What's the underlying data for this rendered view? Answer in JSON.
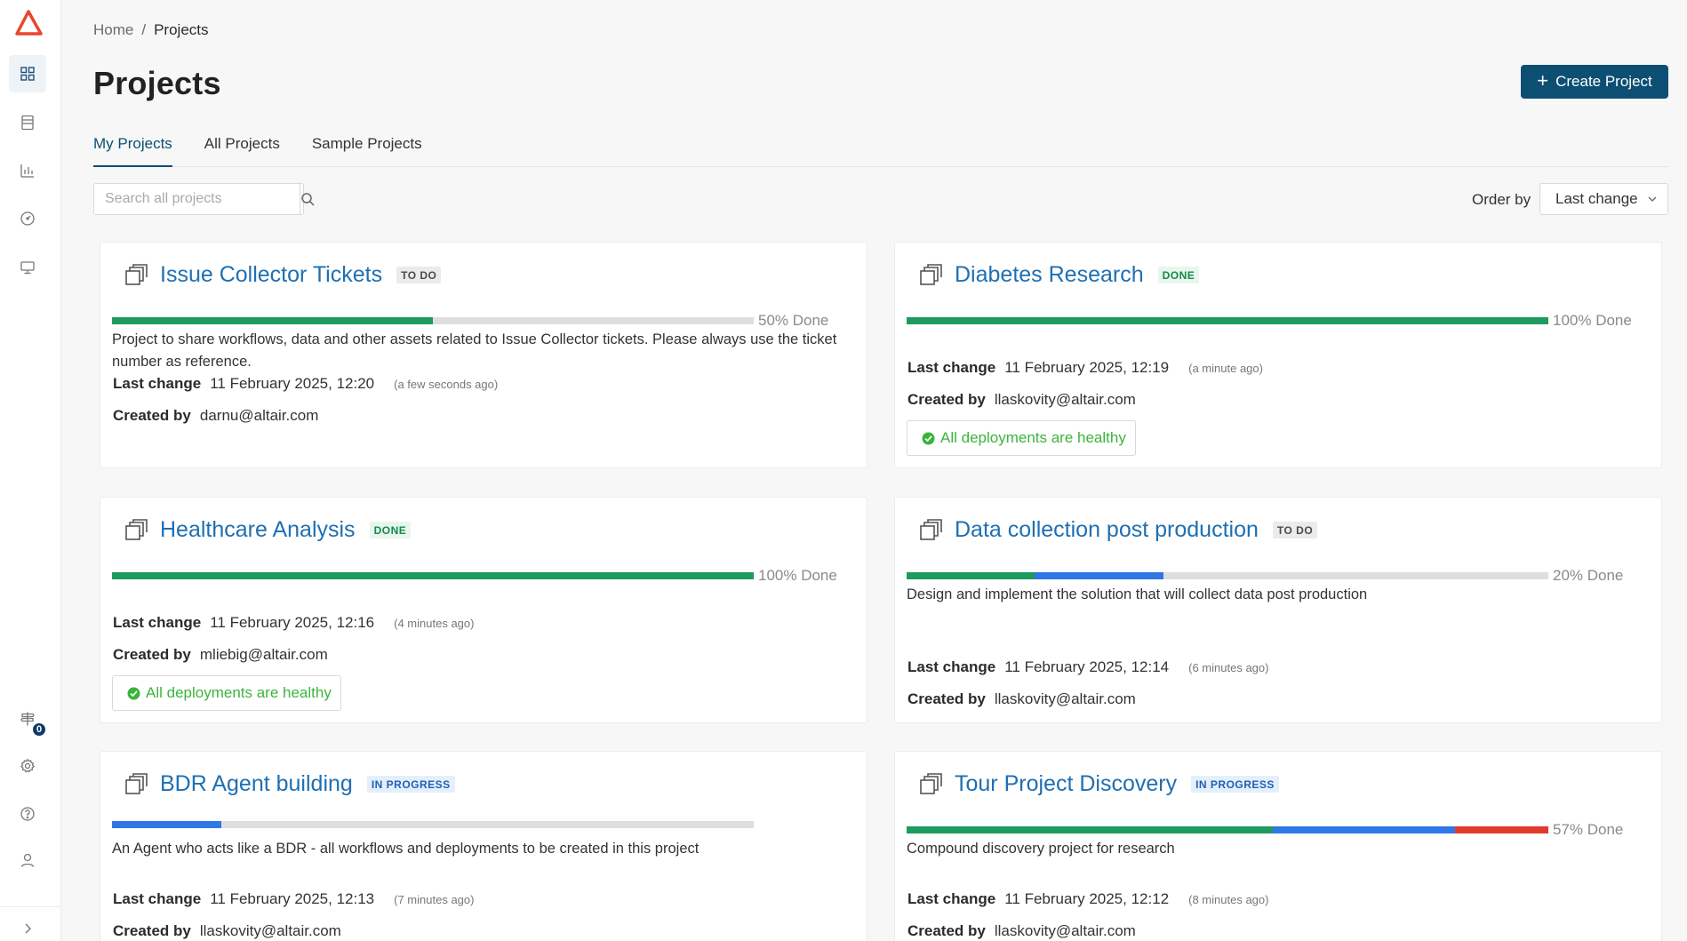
{
  "breadcrumb": {
    "home": "Home",
    "separator": "/",
    "current": "Projects"
  },
  "page": {
    "title": "Projects",
    "create_label": "Create Project"
  },
  "tabs": [
    {
      "label": "My Projects",
      "active": true
    },
    {
      "label": "All Projects",
      "active": false
    },
    {
      "label": "Sample Projects",
      "active": false
    }
  ],
  "search": {
    "placeholder": "Search all projects"
  },
  "order": {
    "label": "Order by",
    "value": "Last change"
  },
  "sidebar": {
    "notification_count": "0"
  },
  "labels": {
    "last_change": "Last change",
    "created_by": "Created by",
    "healthy": "All deployments are healthy"
  },
  "colors": {
    "accent": "#0d4f73",
    "link": "#1f6fb2",
    "green": "#1e9b5f",
    "blue": "#2f77e6",
    "red": "#e23b2e",
    "healthy": "#3cb43c"
  },
  "projects": [
    {
      "title": "Issue Collector Tickets",
      "status": "TO DO",
      "progress_label": "50% Done",
      "progress": [
        0.5,
        0,
        0
      ],
      "description": "Project to share workflows, data and other assets related to Issue Collector tickets. Please always use the ticket number as reference.",
      "last_change": "11 February 2025, 12:20",
      "ago": "(a few seconds ago)",
      "created_by": "darnu@altair.com",
      "healthy": false
    },
    {
      "title": "Diabetes Research",
      "status": "DONE",
      "progress_label": "100% Done",
      "progress": [
        1,
        0,
        0
      ],
      "description": "",
      "last_change": "11 February 2025, 12:19",
      "ago": "(a minute ago)",
      "created_by": "llaskovity@altair.com",
      "healthy": true
    },
    {
      "title": "Healthcare Analysis",
      "status": "DONE",
      "progress_label": "100% Done",
      "progress": [
        1,
        0,
        0
      ],
      "description": "",
      "last_change": "11 February 2025, 12:16",
      "ago": "(4 minutes ago)",
      "created_by": "mliebig@altair.com",
      "healthy": true
    },
    {
      "title": "Data collection post production",
      "status": "TO DO",
      "progress_label": "20% Done",
      "progress": [
        0.2,
        0.2,
        0
      ],
      "description": "Design and implement the solution that will collect data post production",
      "last_change": "11 February 2025, 12:14",
      "ago": "(6 minutes ago)",
      "created_by": "llaskovity@altair.com",
      "healthy": false
    },
    {
      "title": "BDR Agent building",
      "status": "IN PROGRESS",
      "progress_label": "",
      "progress": [
        0,
        0.17,
        0
      ],
      "description": "An Agent who acts like a BDR - all workflows and deployments to be created in this project",
      "last_change": "11 February 2025, 12:13",
      "ago": "(7 minutes ago)",
      "created_by": "llaskovity@altair.com",
      "healthy": false
    },
    {
      "title": "Tour Project Discovery",
      "status": "IN PROGRESS",
      "progress_label": "57% Done",
      "progress": [
        0.57,
        0.285,
        0.145
      ],
      "description": "Compound discovery project for research",
      "last_change": "11 February 2025, 12:12",
      "ago": "(8 minutes ago)",
      "created_by": "llaskovity@altair.com",
      "healthy": false
    }
  ]
}
